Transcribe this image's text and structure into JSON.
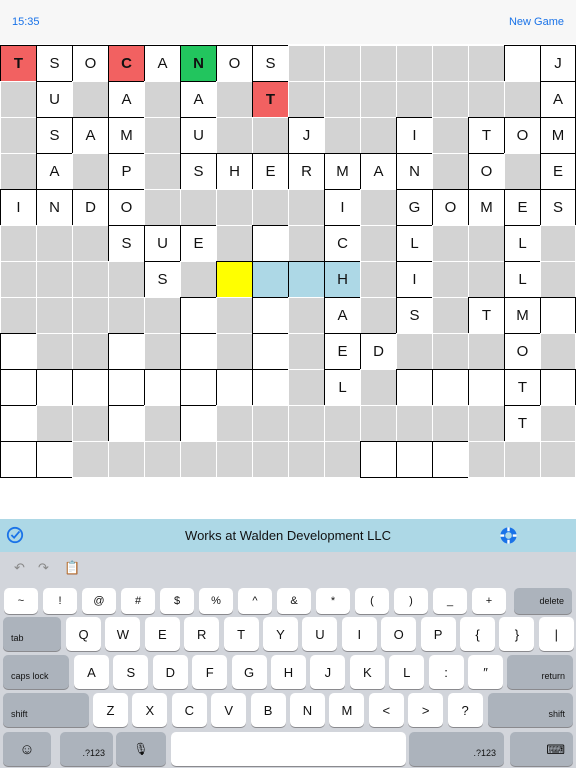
{
  "status": {
    "time": "15:35"
  },
  "header": {
    "new_game_label": "New Game"
  },
  "grid": {
    "rows": [
      [
        "T",
        "S",
        "O",
        "C",
        "A",
        "N",
        "O",
        "S",
        "#",
        "#",
        "#",
        "#",
        "#",
        "#",
        " ",
        "J"
      ],
      [
        "#",
        "U",
        "#",
        "A",
        "#",
        "A",
        "#",
        "T",
        "#",
        "#",
        "#",
        "#",
        "#",
        "#",
        "#",
        "A"
      ],
      [
        "#",
        "S",
        "A",
        "M",
        "#",
        "U",
        "#",
        "#",
        "J",
        "#",
        "#",
        "I",
        "#",
        "T",
        "O",
        "M"
      ],
      [
        "#",
        "A",
        "#",
        "P",
        "#",
        "S",
        "H",
        "E",
        "R",
        "M",
        "A",
        "N",
        "#",
        "O",
        "#",
        "E"
      ],
      [
        "I",
        "N",
        "D",
        "O",
        "#",
        "#",
        "#",
        "#",
        "#",
        "I",
        "#",
        "G",
        "O",
        "M",
        "E",
        "S"
      ],
      [
        "#",
        "#",
        "#",
        "S",
        "U",
        "E",
        "#",
        " ",
        "#",
        "C",
        "#",
        "L",
        "#",
        "#",
        "L",
        "#"
      ],
      [
        "#",
        "#",
        "#",
        "#",
        "S",
        "#",
        " ",
        " ",
        " ",
        "H",
        "#",
        "I",
        "#",
        "#",
        "L",
        "#"
      ],
      [
        "#",
        "#",
        "#",
        "#",
        "#",
        " ",
        "#",
        " ",
        "#",
        "A",
        "#",
        "S",
        "#",
        "T",
        "M",
        " "
      ],
      [
        " ",
        "#",
        "#",
        " ",
        "#",
        " ",
        "#",
        " ",
        "#",
        "E",
        "D",
        "#",
        "#",
        "#",
        "O",
        "#"
      ],
      [
        " ",
        " ",
        " ",
        " ",
        " ",
        " ",
        " ",
        " ",
        "#",
        "L",
        "#",
        " ",
        " ",
        " ",
        "T",
        " "
      ],
      [
        " ",
        "#",
        "#",
        " ",
        "#",
        " ",
        "#",
        "#",
        "#",
        "#",
        "#",
        "#",
        "#",
        "#",
        "T",
        "#"
      ],
      [
        " ",
        " ",
        "#",
        "#",
        "#",
        "#",
        "#",
        "#",
        "#",
        "#",
        " ",
        " ",
        " ",
        "#",
        "#",
        "#"
      ]
    ],
    "red_cells": [
      [
        0,
        0
      ],
      [
        0,
        3
      ],
      [
        1,
        7
      ]
    ],
    "green_cells": [
      [
        0,
        5
      ]
    ],
    "yellow_cells": [
      [
        6,
        6
      ]
    ],
    "highlight_cells": [
      [
        6,
        7
      ],
      [
        6,
        8
      ],
      [
        6,
        9
      ]
    ],
    "colors": {
      "red": "#f26161",
      "green": "#22c55e",
      "yellow": "#ffff00",
      "highlight": "#add8e6",
      "block": "#d3d3d3",
      "link": "#1a73e8"
    }
  },
  "clue": {
    "text": "Works at Walden Development LLC",
    "left_icon": "checkmark-circle-icon",
    "right_icon": "life-ring-icon"
  },
  "keyboard": {
    "toolbar": [
      "undo-icon",
      "redo-icon",
      "paste-icon"
    ],
    "row1": [
      "~",
      "!",
      "@",
      "#",
      "$",
      "%",
      "^",
      "&",
      "*",
      "(",
      ")",
      "_",
      "+"
    ],
    "row1_action": "delete",
    "row2_action": "tab",
    "row2": [
      "Q",
      "W",
      "E",
      "R",
      "T",
      "Y",
      "U",
      "I",
      "O",
      "P",
      "{",
      "}",
      "|"
    ],
    "row3_action": "caps lock",
    "row3": [
      "A",
      "S",
      "D",
      "F",
      "G",
      "H",
      "J",
      "K",
      "L",
      ":",
      "″"
    ],
    "row3_end": "return",
    "row4_start": "shift",
    "row4": [
      "Z",
      "X",
      "C",
      "V",
      "B",
      "N",
      "M",
      "<",
      ">",
      "?"
    ],
    "row4_end": "shift",
    "row5_numbers": ".?123",
    "row5_icons": [
      "emoji-icon",
      "microphone-icon",
      "keyboard-hide-icon"
    ]
  }
}
